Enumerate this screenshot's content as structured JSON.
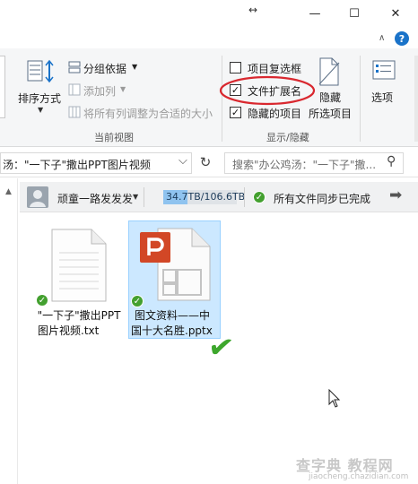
{
  "window": {
    "drag_indicator": "↔",
    "minimize_glyph": "—",
    "maximize_glyph": "☐",
    "close_glyph": "✕",
    "help_glyph": "?",
    "collapse_glyph": "∧"
  },
  "ribbon": {
    "current_view": {
      "sort_label": "排序方式",
      "group_by": "分组依据",
      "add_column": "添加列",
      "fit_columns": "将所有列调整为合适的大小",
      "group_label": "当前视图"
    },
    "show_hide": {
      "item_checkboxes": "项目复选框",
      "file_extensions": "文件扩展名",
      "hidden_items": "隐藏的项目",
      "hide_selected_top": "隐藏",
      "hide_selected_bottom": "所选项目",
      "group_label": "显示/隐藏",
      "checkbox_states": {
        "item_checkboxes": false,
        "file_extensions": true,
        "hidden_items": true
      }
    },
    "options_label": "选项"
  },
  "address": {
    "path_text": "汤：\"一下子\"撒出PPT图片视频",
    "dropdown_glyph": "⌵",
    "refresh_glyph": "↻",
    "search_placeholder": "搜索\"办公鸡汤：\"一下子\"撒...",
    "search_glyph": "⚲"
  },
  "sync_bar": {
    "user_name": "顽童一路发发发",
    "storage": "34.7TB/106.6TB",
    "storage_fraction": 0.325,
    "status": "所有文件同步已完成",
    "arrow_glyph": "➡"
  },
  "files": [
    {
      "name_line1": "\"一下子\"撒出PPT",
      "name_line2": "图片视频.txt",
      "selected": false
    },
    {
      "name_line1": "图文资料——中",
      "name_line2": "国十大名胜.pptx",
      "selected": true
    }
  ],
  "annotation_check": "✔",
  "watermark": {
    "line1": "查字典 教程网",
    "line2": "jiaocheng.chazidian.com"
  },
  "colors": {
    "accent_blue": "#1a73c9",
    "selection_bg": "#cce8ff",
    "selection_border": "#99d1ff",
    "sync_green": "#43a02f",
    "highlight_red": "#d9282f",
    "ppt_orange": "#d24726"
  }
}
